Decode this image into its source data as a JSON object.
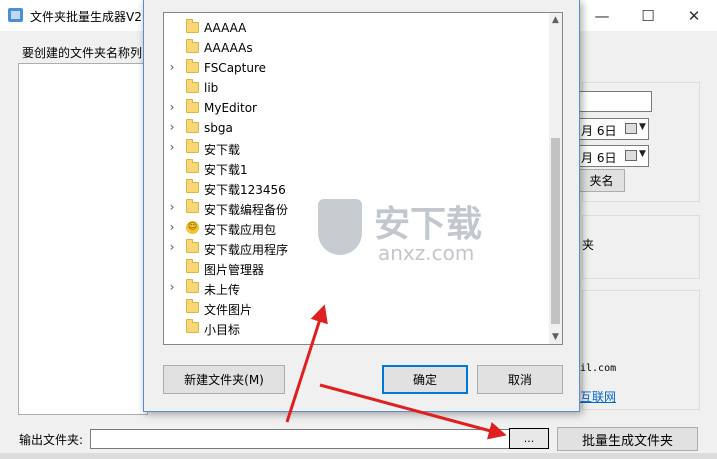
{
  "app": {
    "title": "文件夹批量生成器V2.",
    "window_controls": {
      "minimize": "—",
      "maximize": "☐",
      "close": "✕"
    }
  },
  "main": {
    "folder_list_label": "要创建的文件夹名称列:",
    "right_panel": {
      "date1": "月 6日",
      "date2": "月 6日",
      "rename_button": "夹名",
      "label": "夹",
      "email": "il.com",
      "website": "互联网"
    },
    "output": {
      "label": "输出文件夹:",
      "value": "",
      "browse_button": "...",
      "generate_button": "批量生成文件夹"
    }
  },
  "dialog": {
    "tree": [
      {
        "label": "AAAAA",
        "expandable": false,
        "icon": "folder-icon"
      },
      {
        "label": "AAAAAs",
        "expandable": false,
        "icon": "folder-icon"
      },
      {
        "label": "FSCapture",
        "expandable": true,
        "icon": "folder-icon"
      },
      {
        "label": "lib",
        "expandable": false,
        "icon": "folder-icon"
      },
      {
        "label": "MyEditor",
        "expandable": true,
        "icon": "folder-icon"
      },
      {
        "label": "sbga",
        "expandable": true,
        "icon": "folder-icon"
      },
      {
        "label": "安下载",
        "expandable": true,
        "icon": "folder-icon"
      },
      {
        "label": "安下载1",
        "expandable": false,
        "icon": "folder-icon"
      },
      {
        "label": "安下载123456",
        "expandable": false,
        "icon": "folder-icon"
      },
      {
        "label": "安下载编程备份",
        "expandable": true,
        "icon": "folder-icon"
      },
      {
        "label": "安下载应用包",
        "expandable": true,
        "icon": "smiley-icon"
      },
      {
        "label": "安下载应用程序",
        "expandable": true,
        "icon": "folder-icon"
      },
      {
        "label": "图片管理器",
        "expandable": false,
        "icon": "folder-icon"
      },
      {
        "label": "未上传",
        "expandable": true,
        "icon": "folder-icon"
      },
      {
        "label": "文件图片",
        "expandable": false,
        "icon": "folder-icon"
      },
      {
        "label": "小目标",
        "expandable": false,
        "icon": "folder-icon"
      }
    ],
    "buttons": {
      "new_folder": "新建文件夹(M)",
      "ok": "确定",
      "cancel": "取消"
    }
  },
  "watermark": {
    "text": "安下载",
    "sub": "anxz.com"
  },
  "colors": {
    "accent": "#0078d7",
    "arrow": "#e02020",
    "folder": "#f8d775"
  }
}
